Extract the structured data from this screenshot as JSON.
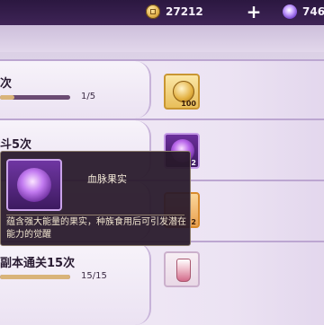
{
  "topbar": {
    "coin_value": "27212",
    "plus_label": "+",
    "gem_value": "746"
  },
  "tasks": [
    {
      "title": "次",
      "progress_text": "1/5",
      "progress": 0.2,
      "reward_count": "100"
    },
    {
      "title": "斗5次",
      "reward_count": "2"
    },
    {
      "title": "",
      "reward_count": "2"
    },
    {
      "title": "副本通关15次",
      "progress_text": "15/15",
      "progress": 1.0,
      "reward_count": ""
    }
  ],
  "tooltip": {
    "item_name": "血脉果实",
    "description": "蕴含强大能量的果实，种族食用后可引发潜在能力的觉醒"
  }
}
